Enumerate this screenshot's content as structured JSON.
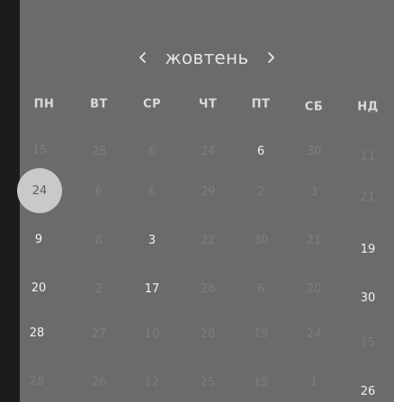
{
  "calendar": {
    "month_label": "жовтень",
    "prev_symbol": "‹",
    "next_symbol": "›",
    "weekdays": [
      "ПН",
      "ВТ",
      "СР",
      "ЧТ",
      "ПТ",
      "СБ",
      "НД"
    ],
    "weeks": [
      [
        {
          "t": "15",
          "s": "muted"
        },
        {
          "t": "28",
          "s": "muted"
        },
        {
          "t": "6",
          "s": "muted"
        },
        {
          "t": "24",
          "s": "muted"
        },
        {
          "t": "6",
          "s": "current"
        },
        {
          "t": "30",
          "s": "muted"
        },
        {
          "t": "11",
          "s": "muted"
        }
      ],
      [
        {
          "t": "24",
          "s": "selected"
        },
        {
          "t": "6",
          "s": "muted"
        },
        {
          "t": "6",
          "s": "muted"
        },
        {
          "t": "29",
          "s": "muted"
        },
        {
          "t": "2",
          "s": "muted"
        },
        {
          "t": "3",
          "s": "muted"
        },
        {
          "t": "21",
          "s": "muted"
        }
      ],
      [
        {
          "t": "9",
          "s": "current"
        },
        {
          "t": "8",
          "s": "muted"
        },
        {
          "t": "3",
          "s": "current"
        },
        {
          "t": "22",
          "s": "muted"
        },
        {
          "t": "30",
          "s": "muted"
        },
        {
          "t": "21",
          "s": "muted"
        },
        {
          "t": "19",
          "s": "current"
        }
      ],
      [
        {
          "t": "20",
          "s": "current"
        },
        {
          "t": "2",
          "s": "muted"
        },
        {
          "t": "17",
          "s": "current"
        },
        {
          "t": "28",
          "s": "muted"
        },
        {
          "t": "6",
          "s": "muted"
        },
        {
          "t": "20",
          "s": "muted"
        },
        {
          "t": "30",
          "s": "current"
        }
      ],
      [
        {
          "t": "28",
          "s": "current"
        },
        {
          "t": "27",
          "s": "muted"
        },
        {
          "t": "10",
          "s": "muted"
        },
        {
          "t": "28",
          "s": "muted"
        },
        {
          "t": "19",
          "s": "muted"
        },
        {
          "t": "24",
          "s": "muted"
        },
        {
          "t": "15",
          "s": "muted"
        }
      ],
      [
        {
          "t": "28",
          "s": "muted"
        },
        {
          "t": "26",
          "s": "muted"
        },
        {
          "t": "12",
          "s": "muted"
        },
        {
          "t": "25",
          "s": "muted"
        },
        {
          "t": "15",
          "s": "muted"
        },
        {
          "t": "1",
          "s": "muted"
        },
        {
          "t": "26",
          "s": "current"
        }
      ]
    ]
  }
}
